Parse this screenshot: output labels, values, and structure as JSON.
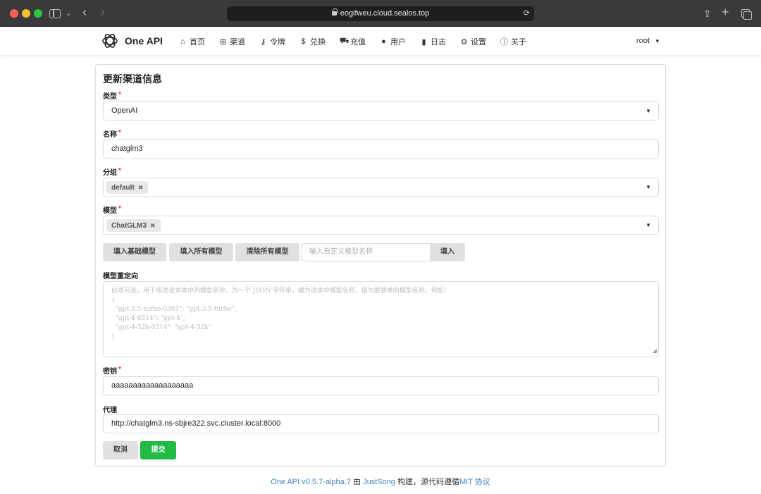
{
  "browser": {
    "url": "eogifweu.cloud.sealos.top"
  },
  "header": {
    "brand": "One API",
    "menu": [
      {
        "label": "首页",
        "icon": "home-icon"
      },
      {
        "label": "渠道",
        "icon": "sitemap-icon"
      },
      {
        "label": "令牌",
        "icon": "key-icon"
      },
      {
        "label": "兑换",
        "icon": "dollar-icon"
      },
      {
        "label": "充值",
        "icon": "cart-icon"
      },
      {
        "label": "用户",
        "icon": "user-icon"
      },
      {
        "label": "日志",
        "icon": "book-icon"
      },
      {
        "label": "设置",
        "icon": "gear-icon"
      },
      {
        "label": "关于",
        "icon": "info-icon"
      }
    ],
    "user": "root"
  },
  "form": {
    "title": "更新渠道信息",
    "type": {
      "label": "类型",
      "value": "OpenAI"
    },
    "name": {
      "label": "名称",
      "value": "chatglm3"
    },
    "group": {
      "label": "分组",
      "tag": "default"
    },
    "models": {
      "label": "模型",
      "tag": "ChatGLM3"
    },
    "buttons": {
      "fill_basic": "填入基础模型",
      "fill_all": "填入所有模型",
      "clear_all": "清除所有模型",
      "custom_placeholder": "输入自定义模型名称",
      "fill": "填入"
    },
    "redirect": {
      "label": "模型重定向",
      "placeholder": "此项可选，用于修改请求体中的模型名称，为一个 JSON 字符串，键为请求中模型名称，值为要替换的模型名称，例如：\n{\n  \"gpt-3.5-turbo-0301\": \"gpt-3.5-turbo\",\n  \"gpt-4-0314\": \"gpt-4\",\n  \"gpt-4-32k-0314\": \"gpt-4-32k\"\n}"
    },
    "key": {
      "label": "密钥",
      "value": "aaaaaaaaaaaaaaaaaaa"
    },
    "proxy": {
      "label": "代理",
      "value": "http://chatglm3.ns-sbjre322.svc.cluster.local:8000"
    },
    "cancel": "取消",
    "submit": "提交"
  },
  "footer": {
    "version": "One API v0.5.7-alpha.7",
    "by": "由",
    "author": "JustSong",
    "built": "构建，源代码遵循",
    "license": "MIT 协议"
  },
  "colors": {
    "submit": "#21ba45",
    "link": "#4183c4",
    "required": "#db2828"
  }
}
